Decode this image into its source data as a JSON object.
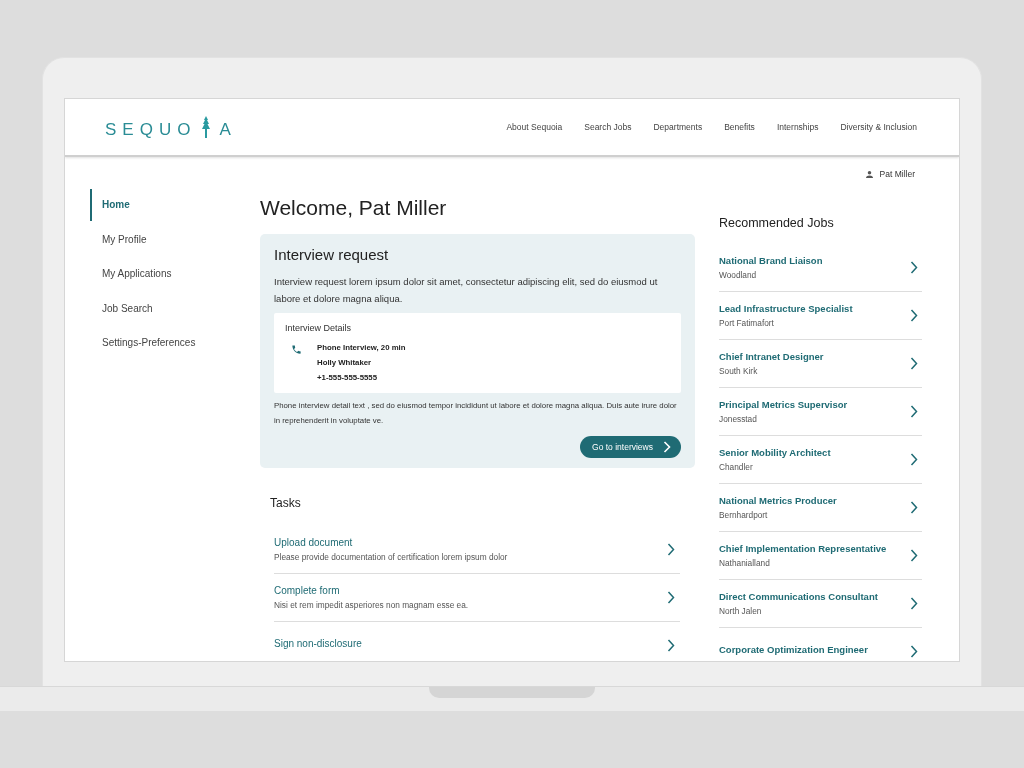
{
  "logo": {
    "before": "SEQUO",
    "after": "A"
  },
  "nav": [
    "About Sequoia",
    "Search Jobs",
    "Departments",
    "Benefits",
    "Internships",
    "Diversity & Inclusion"
  ],
  "user": {
    "name": "Pat Miller"
  },
  "sidebar": {
    "items": [
      {
        "label": "Home",
        "selected": true
      },
      {
        "label": "My Profile",
        "selected": false
      },
      {
        "label": "My Applications",
        "selected": false
      },
      {
        "label": "Job Search",
        "selected": false
      },
      {
        "label": "Settings-Preferences",
        "selected": false
      }
    ]
  },
  "welcome": "Welcome, Pat Miller",
  "interview_card": {
    "title": "Interview request",
    "text": "Interview request lorem ipsum dolor sit amet, consectetur adipiscing elit, sed do eiusmod ut labore et dolore magna aliqua.",
    "details_title": "Interview Details",
    "details": [
      "Phone Interview, 20 min",
      "Holly Whitaker",
      "+1-555-555-5555"
    ],
    "note": "Phone interview detail text , sed do eiusmod tempor incididunt ut labore et dolore magna aliqua. Duis aute irure dolor in reprehenderit in voluptate ve.",
    "button": "Go to interviews"
  },
  "tasks": {
    "title": "Tasks",
    "items": [
      {
        "title": "Upload document",
        "text": "Please provide documentation of certification lorem ipsum dolor"
      },
      {
        "title": "Complete form",
        "text": "Nisi et rem impedit asperiores non magnam esse ea."
      },
      {
        "title": "Sign non-disclosure"
      }
    ]
  },
  "recommended": {
    "title": "Recommended Jobs",
    "items": [
      {
        "title": "National Brand Liaison",
        "location": "Woodland"
      },
      {
        "title": "Lead Infrastructure Specialist",
        "location": "Port Fatimafort"
      },
      {
        "title": "Chief Intranet Designer",
        "location": "South Kirk"
      },
      {
        "title": "Principal Metrics Supervisor",
        "location": "Jonesstad"
      },
      {
        "title": "Senior Mobility Architect",
        "location": "Chandler"
      },
      {
        "title": "National Metrics Producer",
        "location": "Bernhardport"
      },
      {
        "title": "Chief Implementation Representative",
        "location": "Nathanialland"
      },
      {
        "title": "Direct Communications Consultant",
        "location": "North Jalen"
      },
      {
        "title": "Corporate Optimization Engineer"
      }
    ]
  }
}
